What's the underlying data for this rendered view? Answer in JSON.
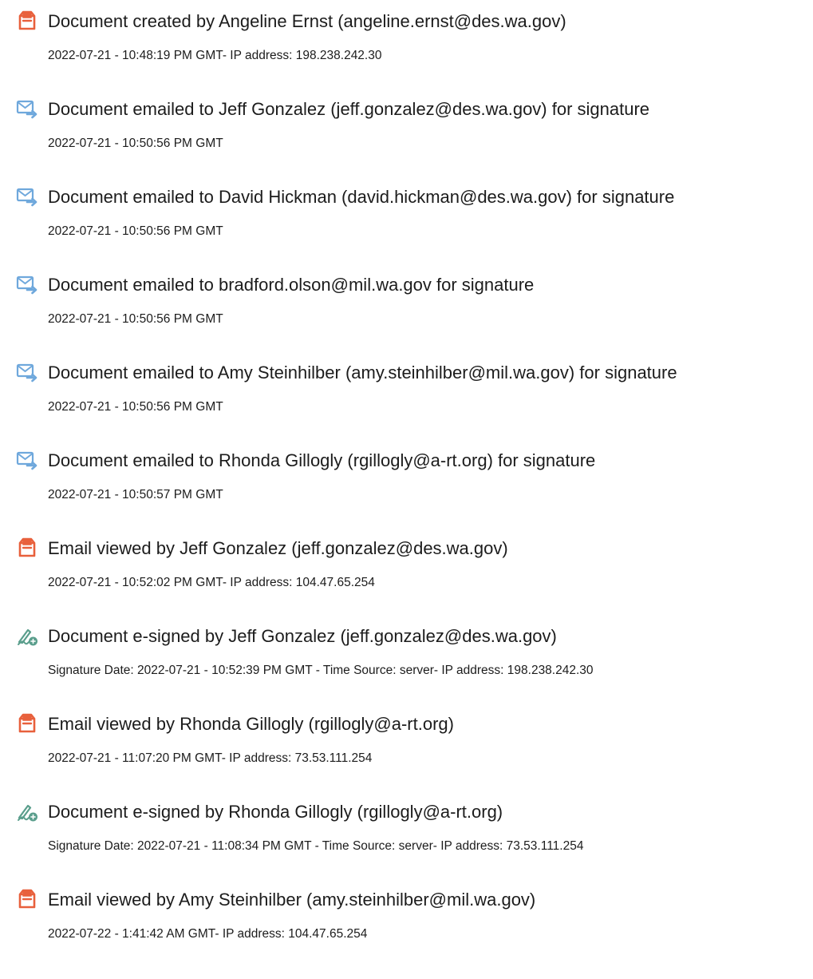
{
  "colors": {
    "document_icon": "#e8603c",
    "email_icon": "#6fa8dc",
    "sign_icon": "#5a9e8c",
    "text": "#1c1c1c"
  },
  "events": [
    {
      "icon": "document-created-icon",
      "title": "Document created by Angeline Ernst (angeline.ernst@des.wa.gov)",
      "detail": "2022-07-21 - 10:48:19 PM GMT- IP address: 198.238.242.30"
    },
    {
      "icon": "email-sent-icon",
      "title": "Document emailed to Jeff Gonzalez (jeff.gonzalez@des.wa.gov) for signature",
      "detail": "2022-07-21 - 10:50:56 PM GMT"
    },
    {
      "icon": "email-sent-icon",
      "title": "Document emailed to David Hickman (david.hickman@des.wa.gov) for signature",
      "detail": "2022-07-21 - 10:50:56 PM GMT"
    },
    {
      "icon": "email-sent-icon",
      "title": "Document emailed to bradford.olson@mil.wa.gov for signature",
      "detail": "2022-07-21 - 10:50:56 PM GMT"
    },
    {
      "icon": "email-sent-icon",
      "title": "Document emailed to Amy Steinhilber (amy.steinhilber@mil.wa.gov) for signature",
      "detail": "2022-07-21 - 10:50:56 PM GMT"
    },
    {
      "icon": "email-sent-icon",
      "title": "Document emailed to Rhonda Gillogly (rgillogly@a-rt.org) for signature",
      "detail": "2022-07-21 - 10:50:57 PM GMT"
    },
    {
      "icon": "email-viewed-icon",
      "title": "Email viewed by Jeff Gonzalez (jeff.gonzalez@des.wa.gov)",
      "detail": "2022-07-21 - 10:52:02 PM GMT- IP address: 104.47.65.254"
    },
    {
      "icon": "e-signed-icon",
      "title": "Document e-signed by Jeff Gonzalez (jeff.gonzalez@des.wa.gov)",
      "detail": "Signature Date: 2022-07-21 - 10:52:39 PM GMT - Time Source: server- IP address: 198.238.242.30"
    },
    {
      "icon": "email-viewed-icon",
      "title": "Email viewed by Rhonda Gillogly (rgillogly@a-rt.org)",
      "detail": "2022-07-21 - 11:07:20 PM GMT- IP address: 73.53.111.254"
    },
    {
      "icon": "e-signed-icon",
      "title": "Document e-signed by Rhonda Gillogly (rgillogly@a-rt.org)",
      "detail": "Signature Date: 2022-07-21 - 11:08:34 PM GMT - Time Source: server- IP address: 73.53.111.254"
    },
    {
      "icon": "email-viewed-icon",
      "title": "Email viewed by Amy Steinhilber (amy.steinhilber@mil.wa.gov)",
      "detail": "2022-07-22 - 1:41:42 AM GMT- IP address: 104.47.65.254"
    }
  ]
}
